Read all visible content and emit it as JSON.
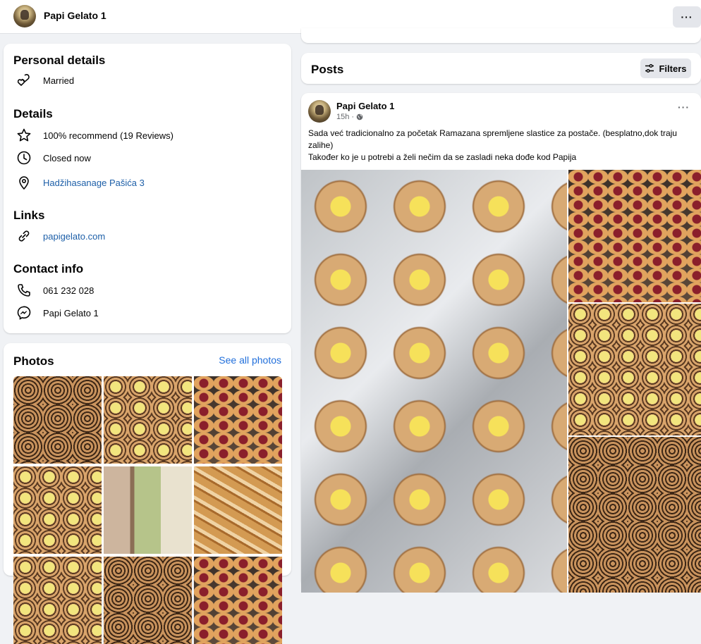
{
  "header": {
    "page_name": "Papi Gelato 1",
    "more_label": "···"
  },
  "personal_details": {
    "title": "Personal details",
    "relationship": "Married"
  },
  "details": {
    "title": "Details",
    "recommend": "100% recommend (19 Reviews)",
    "hours": "Closed now",
    "address": "Hadžihasanage Pašića 3"
  },
  "links": {
    "title": "Links",
    "website": "papigelato.com"
  },
  "contact": {
    "title": "Contact info",
    "phone": "061 232 028",
    "messenger": "Papi Gelato 1"
  },
  "photos": {
    "title": "Photos",
    "see_all": "See all photos"
  },
  "posts": {
    "title": "Posts",
    "filters_label": "Filters"
  },
  "post": {
    "author": "Papi Gelato 1",
    "time": "15h",
    "more_label": "···",
    "text_line1": "Sada već tradicionalno za početak Ramazana spremljene slastice za postače. (besplatno,dok traju zalihe)",
    "text_line2": "Također ko je u potrebi a želi nečim da se zasladi neka dođe kod Papija"
  },
  "colors": {
    "background": "#f0f2f5",
    "card": "#ffffff",
    "link": "#216fdb",
    "muted": "#65676b"
  }
}
